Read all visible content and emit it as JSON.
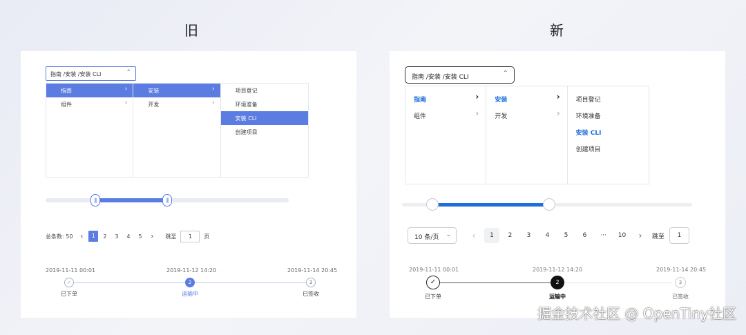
{
  "headings": {
    "old": "旧",
    "new": "新"
  },
  "old": {
    "select_value": "指南 /安装 /安装 CLI",
    "cascader": {
      "col1": [
        "指南",
        "组件"
      ],
      "col2": [
        "安装",
        "开发"
      ],
      "col3": [
        "项目登记",
        "环境准备",
        "安装 CLI",
        "创建项目"
      ]
    },
    "slider": {
      "low": 0.2,
      "high": 0.5
    },
    "pager": {
      "total_label": "总条数: 50",
      "pages": [
        "1",
        "2",
        "3",
        "4",
        "5"
      ],
      "current": "1",
      "jump_label": "跳至",
      "jump_value": "1",
      "page_unit": "页"
    },
    "timeline": {
      "times": [
        "2019-11-11 00:01",
        "2019-11-12 14:20",
        "2019-11-14 20:45"
      ],
      "steps": [
        "已下单",
        "运输中",
        "已签收"
      ],
      "nodes": [
        "✓",
        "2",
        "3"
      ]
    }
  },
  "new": {
    "select_value": "指南 /安装 /安装 CLI",
    "cascader": {
      "col1": [
        "指南",
        "组件"
      ],
      "col2": [
        "安装",
        "开发"
      ],
      "col3": [
        "项目登记",
        "环境准备",
        "安装 CLI",
        "创建项目"
      ]
    },
    "slider": {
      "low": 0.1,
      "high": 0.5
    },
    "pager": {
      "page_size": "10 条/页",
      "pages": [
        "1",
        "2",
        "3",
        "4",
        "5",
        "6",
        "···",
        "10"
      ],
      "current": "1",
      "jump_label": "跳至",
      "jump_value": "1"
    },
    "timeline": {
      "times": [
        "2019-11-11 00:01",
        "2019-11-12 14:20",
        "2019-11-14 20:45"
      ],
      "steps": [
        "已下单",
        "运输中",
        "已签收"
      ],
      "nodes": [
        "✓",
        "2",
        "3"
      ]
    }
  },
  "icons": {
    "chevron_up": "⌃",
    "chevron_down": "⌄",
    "chevron_right": "›",
    "chevron_left": "‹"
  },
  "colors": {
    "old_accent": "#5b7ce0",
    "new_accent": "#1e6fd9",
    "new_active_node": "#111111"
  },
  "watermark": "掘金技术社区 @ OpenTiny社区"
}
